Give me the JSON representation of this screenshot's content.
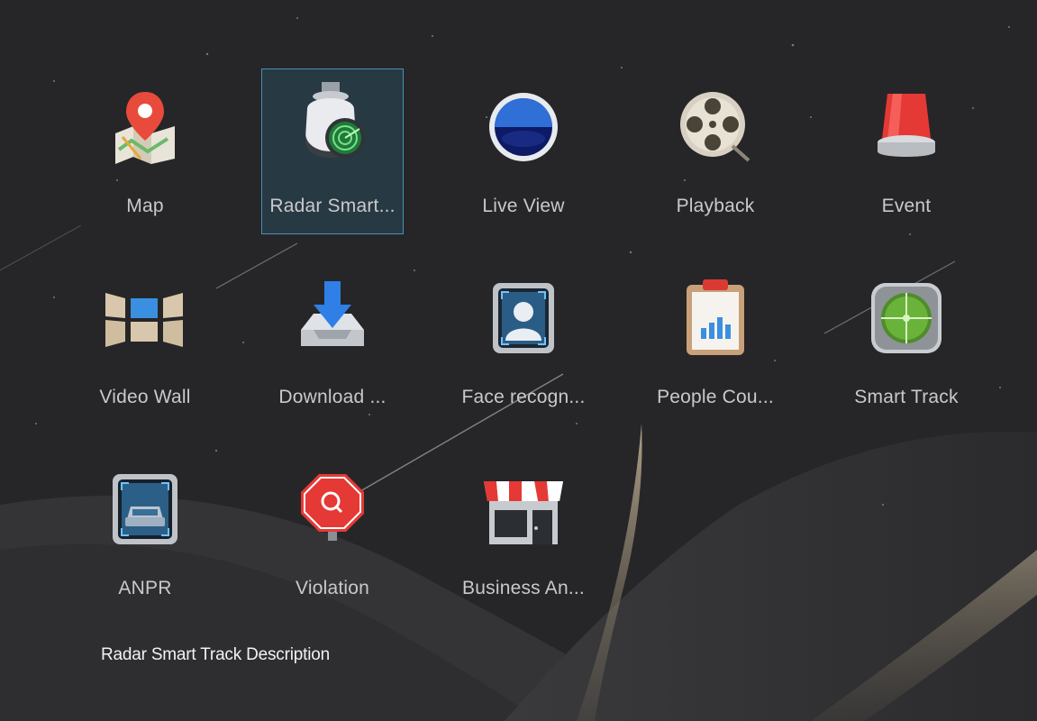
{
  "apps": [
    {
      "id": "map",
      "label": "Map",
      "icon": "map-pin-icon",
      "selected": false
    },
    {
      "id": "radar-smart-track",
      "label": "Radar Smart...",
      "icon": "radar-camera-icon",
      "selected": true
    },
    {
      "id": "live-view",
      "label": "Live View",
      "icon": "live-view-lens-icon",
      "selected": false
    },
    {
      "id": "playback",
      "label": "Playback",
      "icon": "film-reel-icon",
      "selected": false
    },
    {
      "id": "event",
      "label": "Event",
      "icon": "alarm-light-icon",
      "selected": false
    },
    {
      "id": "video-wall",
      "label": "Video Wall",
      "icon": "video-wall-icon",
      "selected": false
    },
    {
      "id": "download",
      "label": "Download ...",
      "icon": "download-tray-icon",
      "selected": false
    },
    {
      "id": "face-recognition",
      "label": "Face recogn...",
      "icon": "face-scan-icon",
      "selected": false
    },
    {
      "id": "people-counting",
      "label": "People Cou...",
      "icon": "clipboard-chart-icon",
      "selected": false
    },
    {
      "id": "smart-track",
      "label": "Smart Track",
      "icon": "target-icon",
      "selected": false
    },
    {
      "id": "anpr",
      "label": "ANPR",
      "icon": "car-scan-icon",
      "selected": false
    },
    {
      "id": "violation",
      "label": "Violation",
      "icon": "violation-sign-icon",
      "selected": false
    },
    {
      "id": "business-analysis",
      "label": "Business An...",
      "icon": "storefront-icon",
      "selected": false
    }
  ],
  "description": "Radar Smart Track Description",
  "colors": {
    "background": "#262628",
    "selection_fill": "#284a5a",
    "selection_border": "#4a90b4",
    "label": "#c9c9cb",
    "description": "#f2f2f2"
  }
}
